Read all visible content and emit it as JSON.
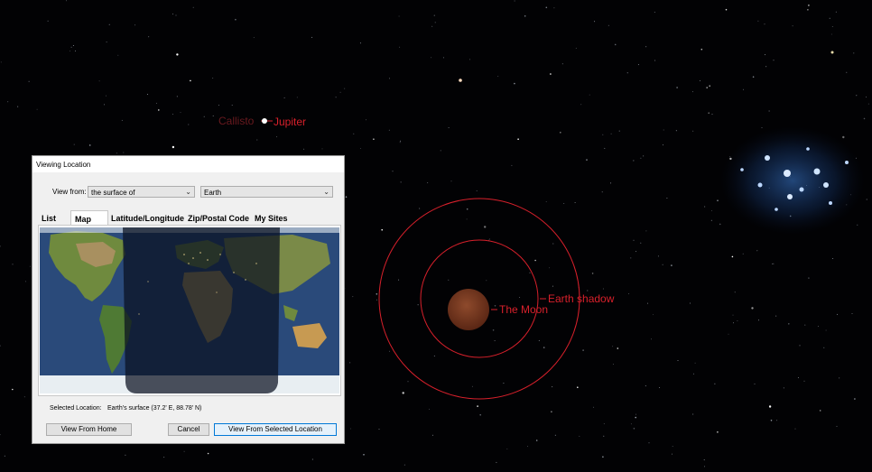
{
  "sky": {
    "labels": {
      "callisto": "Callisto",
      "jupiter": "Jupiter",
      "earth_shadow": "Earth shadow",
      "moon": "The Moon"
    },
    "colors": {
      "label": "#d8202b",
      "moon": "#7a3a22",
      "cluster": "#5aa0ff"
    }
  },
  "dialog": {
    "title": "Viewing Location",
    "view_from_label": "View from:",
    "view_from_mode": "the surface of",
    "view_from_body": "Earth",
    "tabs": [
      {
        "label": "List",
        "active": false
      },
      {
        "label": "Map",
        "active": true
      },
      {
        "label": "Latitude/Longitude",
        "active": false
      },
      {
        "label": "Zip/Postal Code",
        "active": false
      },
      {
        "label": "My Sites",
        "active": false
      }
    ],
    "selected_location_label": "Selected Location:",
    "selected_location_value": "Earth's surface (37.2' E, 88.78' N)",
    "buttons": {
      "home": "View From Home",
      "cancel": "Cancel",
      "confirm": "View From Selected Location"
    }
  }
}
